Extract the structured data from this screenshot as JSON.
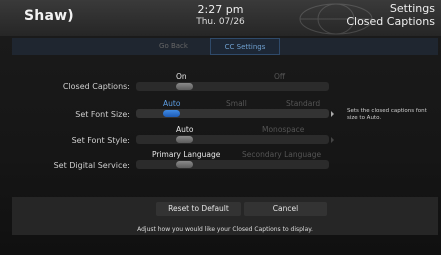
{
  "header": {
    "logo": "Shaw)",
    "time": "2:27 pm",
    "date": "Thu. 07/26",
    "title": "Settings",
    "subtitle": "Closed Captions"
  },
  "tabs": [
    {
      "label": "Go Back"
    },
    {
      "label": "CC Settings"
    }
  ],
  "settings": [
    {
      "label": "Closed Captions:",
      "options": [
        "On",
        "Off"
      ],
      "selected": "On"
    },
    {
      "label": "Set Font Size:",
      "options": [
        "Auto",
        "Small",
        "Standard"
      ],
      "selected": "Auto"
    },
    {
      "label": "Set Font Style:",
      "options": [
        "Auto",
        "Monospace"
      ],
      "selected": "Auto"
    },
    {
      "label": "Set Digital Service:",
      "options": [
        "Primary Language",
        "Secondary Language"
      ],
      "selected": "Primary Language"
    }
  ],
  "help_text": "Sets the closed captions font size to Auto.",
  "buttons": {
    "reset": "Reset to Default",
    "cancel": "Cancel"
  },
  "footer_text": "Adjust how you would like your Closed Captions to display.",
  "colors": {
    "accent": "#3f8be6",
    "header_bg": "#2e2e2e",
    "background": "#161616"
  }
}
